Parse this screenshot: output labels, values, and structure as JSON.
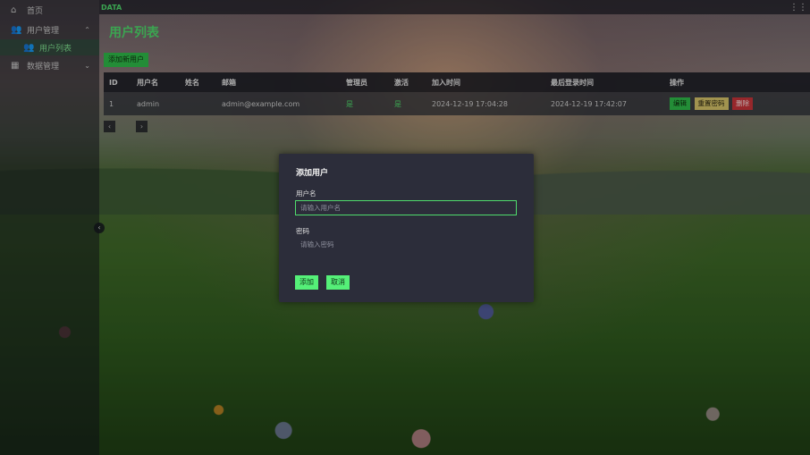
{
  "topbar": {
    "brand": "DATA",
    "grid_icon": "grid-icon"
  },
  "sidebar": {
    "items": [
      {
        "label": "首页",
        "icon": "home-icon"
      },
      {
        "label": "用户管理",
        "icon": "users-icon"
      },
      {
        "label": "用户列表",
        "icon": "user-list-icon"
      },
      {
        "label": "数据管理",
        "icon": "data-icon"
      }
    ]
  },
  "page": {
    "title": "用户列表",
    "add_button": "添加新用户"
  },
  "table": {
    "headers": [
      "ID",
      "用户名",
      "姓名",
      "邮箱",
      "管理员",
      "激活",
      "加入时间",
      "最后登录时间",
      "操作"
    ],
    "rows": [
      {
        "id": "1",
        "username": "admin",
        "name": "",
        "email": "admin@example.com",
        "is_admin": "是",
        "active": "是",
        "joined": "2024-12-19 17:04:28",
        "last_login": "2024-12-19 17:42:07",
        "actions": {
          "edit": "编辑",
          "reset": "重置密码",
          "delete": "删除"
        }
      }
    ]
  },
  "pagination": {
    "prev": "‹",
    "next": "›"
  },
  "modal": {
    "title": "添加用户",
    "username_label": "用户名",
    "username_placeholder": "请输入用户名",
    "password_label": "密码",
    "password_placeholder": "请输入密码",
    "add_button": "添加",
    "cancel_button": "取消"
  },
  "colors": {
    "accent": "#4fdc6c",
    "danger": "#c8353a",
    "warning": "#d7c46a",
    "modal_bg": "#2c2d3a"
  }
}
